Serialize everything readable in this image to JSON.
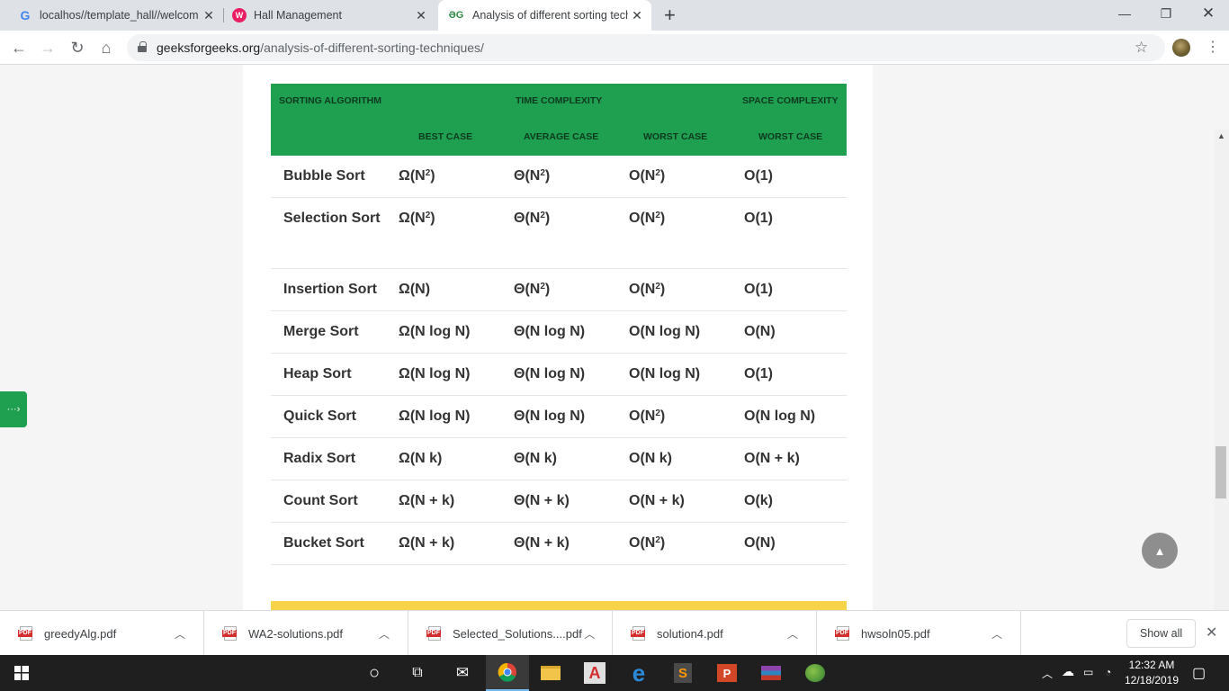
{
  "browser": {
    "tabs": [
      {
        "label": "localhos//template_hall//welcom",
        "icon": "google-icon"
      },
      {
        "label": "Hall Management",
        "icon": "hall-management-icon"
      },
      {
        "label": "Analysis of different sorting techn",
        "icon": "gfg-icon",
        "active": true
      }
    ],
    "url_host": "geeksforgeeks.org",
    "url_path": "/analysis-of-different-sorting-techniques/"
  },
  "table": {
    "headers": {
      "sorting_algorithm": "SORTING ALGORITHM",
      "time_complexity": "TIME COMPLEXITY",
      "space_complexity": "SPACE COMPLEXITY",
      "best_case": "BEST CASE",
      "average_case": "AVERAGE CASE",
      "worst_case_time": "WORST CASE",
      "worst_case_space": "WORST CASE"
    },
    "rows": [
      {
        "name": "Bubble Sort",
        "best": [
          "Ω(N",
          "2",
          ")"
        ],
        "avg": [
          "Θ(N",
          "2",
          ")"
        ],
        "worst": [
          "O(N",
          "2",
          ")"
        ],
        "space": "O(1)"
      },
      {
        "name": "Selection Sort",
        "best": [
          "Ω(N",
          "2",
          ")"
        ],
        "avg": [
          "Θ(N",
          "2",
          ")"
        ],
        "worst": [
          "O(N",
          "2",
          ")"
        ],
        "space": "O(1)"
      },
      {
        "name": "Insertion Sort",
        "best": [
          "Ω(N)",
          "",
          ""
        ],
        "avg": [
          "Θ(N",
          "2",
          ")"
        ],
        "worst": [
          "O(N",
          "2",
          ")"
        ],
        "space": "O(1)"
      },
      {
        "name": "Merge Sort",
        "best": [
          "Ω(N log N)",
          "",
          ""
        ],
        "avg": [
          "Θ(N log N)",
          "",
          ""
        ],
        "worst": [
          "O(N log N)",
          "",
          ""
        ],
        "space": "O(N)"
      },
      {
        "name": "Heap Sort",
        "best": [
          "Ω(N log N)",
          "",
          ""
        ],
        "avg": [
          "Θ(N log N)",
          "",
          ""
        ],
        "worst": [
          "O(N log N)",
          "",
          ""
        ],
        "space": "O(1)"
      },
      {
        "name": "Quick Sort",
        "best": [
          "Ω(N log N)",
          "",
          ""
        ],
        "avg": [
          "Θ(N log N)",
          "",
          ""
        ],
        "worst": [
          "O(N",
          "2",
          ")"
        ],
        "space": "O(N log N)"
      },
      {
        "name": "Radix Sort",
        "best": [
          "Ω(N k)",
          "",
          ""
        ],
        "avg": [
          "Θ(N k)",
          "",
          ""
        ],
        "worst": [
          "O(N k)",
          "",
          ""
        ],
        "space": "O(N + k)"
      },
      {
        "name": "Count Sort",
        "best": [
          "Ω(N + k)",
          "",
          ""
        ],
        "avg": [
          "Θ(N + k)",
          "",
          ""
        ],
        "worst": [
          "O(N + k)",
          "",
          ""
        ],
        "space": "O(k)"
      },
      {
        "name": "Bucket Sort",
        "best": [
          "Ω(N + k)",
          "",
          ""
        ],
        "avg": [
          "Θ(N + k)",
          "",
          ""
        ],
        "worst": [
          "O(N",
          "2",
          ")"
        ],
        "space": "O(N)"
      }
    ]
  },
  "downloads": {
    "items": [
      "greedyAlg.pdf",
      "WA2-solutions.pdf",
      "Selected_Solutions....pdf",
      "solution4.pdf",
      "hwsoln05.pdf"
    ],
    "show_all": "Show all"
  },
  "taskbar": {
    "time": "12:32 AM",
    "date": "12/18/2019"
  },
  "colors": {
    "header_green": "#1f9f50",
    "accent_yellow": "#f7d34a"
  }
}
